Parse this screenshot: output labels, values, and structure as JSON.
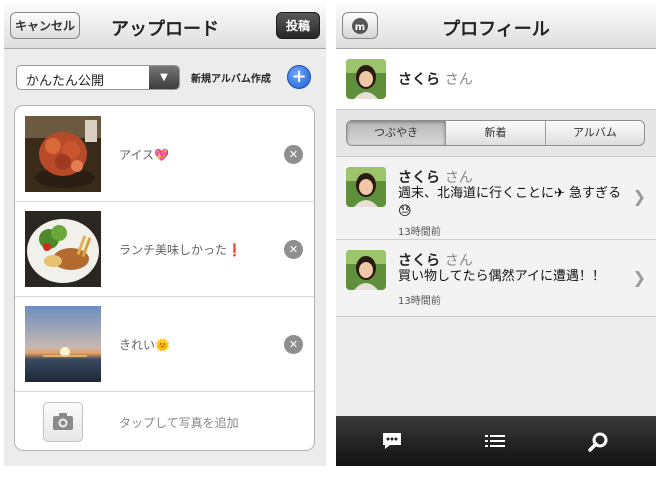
{
  "upload": {
    "cancel_label": "キャンセル",
    "title": "アップロード",
    "post_label": "投稿",
    "visibility": "かんたん公開",
    "new_album": "新規アルバム作成",
    "items": [
      {
        "caption": "アイス",
        "emoji": "💖"
      },
      {
        "caption": "ランチ美味しかった",
        "emoji": "❗"
      },
      {
        "caption": "きれい",
        "emoji": "🌞"
      }
    ],
    "add_photo": "タップして写真を追加"
  },
  "profile": {
    "title": "プロフィール",
    "name": "さくら",
    "honorific": "さん",
    "tabs": [
      "つぶやき",
      "新着",
      "アルバム"
    ],
    "posts": [
      {
        "name": "さくら",
        "honorific": "さん",
        "body": "週末、北海道に行くことに✈ 急すぎる😓",
        "time": "13時間前"
      },
      {
        "name": "さくら",
        "honorific": "さん",
        "body": "買い物してたら偶然アイに遭遇！！",
        "time": "13時間前"
      }
    ]
  },
  "colors": {
    "accent_blue": "#1d5fd1",
    "navbar": "#e4e4e4",
    "tabbar": "#1f1f1f"
  }
}
